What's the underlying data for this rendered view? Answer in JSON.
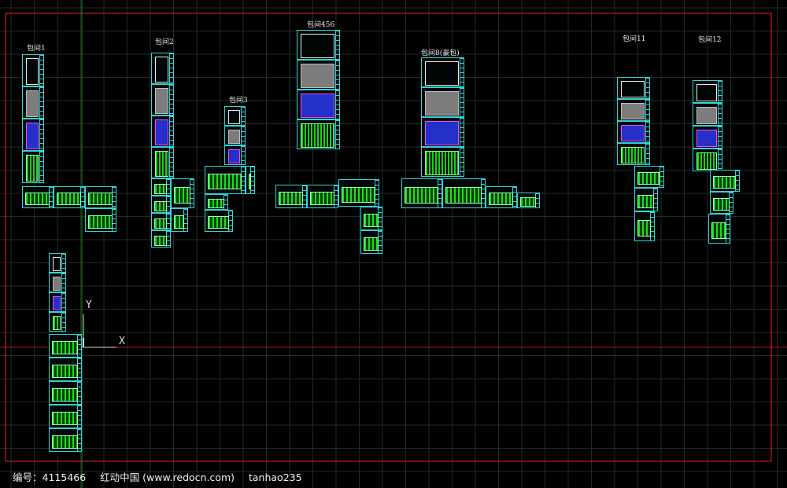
{
  "labels": [
    "包间1",
    "包间2",
    "包间3",
    "包间456",
    "包间8(豪包)",
    "包间11",
    "包间12"
  ],
  "axis": {
    "x": "X",
    "y": "Y"
  },
  "footer": {
    "id_label": "编号：",
    "id_value": "4115466",
    "site": "红动中国 (www.redocn.com)",
    "author": "tanhao235"
  },
  "colors": {
    "background": "#000000",
    "grid": "#1f2a2a",
    "border": "#d01818",
    "sheet": "#2fd6d6"
  }
}
